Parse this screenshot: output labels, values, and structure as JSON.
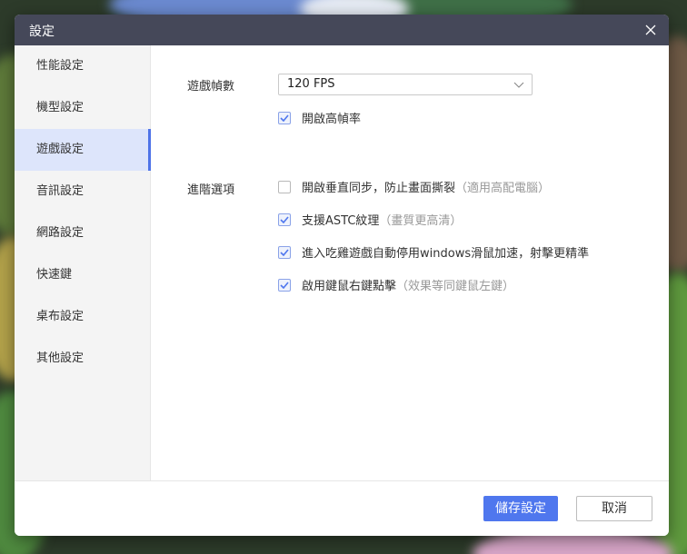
{
  "window": {
    "title": "設定"
  },
  "sidebar": {
    "items": [
      {
        "label": "性能設定"
      },
      {
        "label": "機型設定"
      },
      {
        "label": "遊戲設定",
        "active": true
      },
      {
        "label": "音訊設定"
      },
      {
        "label": "網路設定"
      },
      {
        "label": "快速鍵"
      },
      {
        "label": "桌布設定"
      },
      {
        "label": "其他設定"
      }
    ]
  },
  "game": {
    "fps": {
      "label": "遊戲幀數",
      "selected": "120 FPS",
      "high_fps": {
        "label": "開啟高幀率",
        "checked": true
      }
    },
    "advanced": {
      "label": "進階選項",
      "options": [
        {
          "label": "開啟垂直同步，防止畫面撕裂",
          "hint": "（適用高配電腦）",
          "checked": false
        },
        {
          "label": "支援ASTC紋理",
          "hint": "（畫質更高清）",
          "checked": true
        },
        {
          "label": "進入吃雞遊戲自動停用windows滑鼠加速，射擊更精準",
          "hint": "",
          "checked": true
        },
        {
          "label": "啟用鍵鼠右鍵點擊",
          "hint": "（效果等同鍵鼠左鍵）",
          "checked": true
        }
      ]
    }
  },
  "footer": {
    "save_label": "儲存設定",
    "cancel_label": "取消"
  },
  "colors": {
    "accent": "#4f77ee",
    "titlebar": "#454859",
    "active_nav_bg": "#dde5fb"
  },
  "icons": {
    "close": "close-icon",
    "dropdown": "chevron-down-icon",
    "check": "check-icon"
  }
}
